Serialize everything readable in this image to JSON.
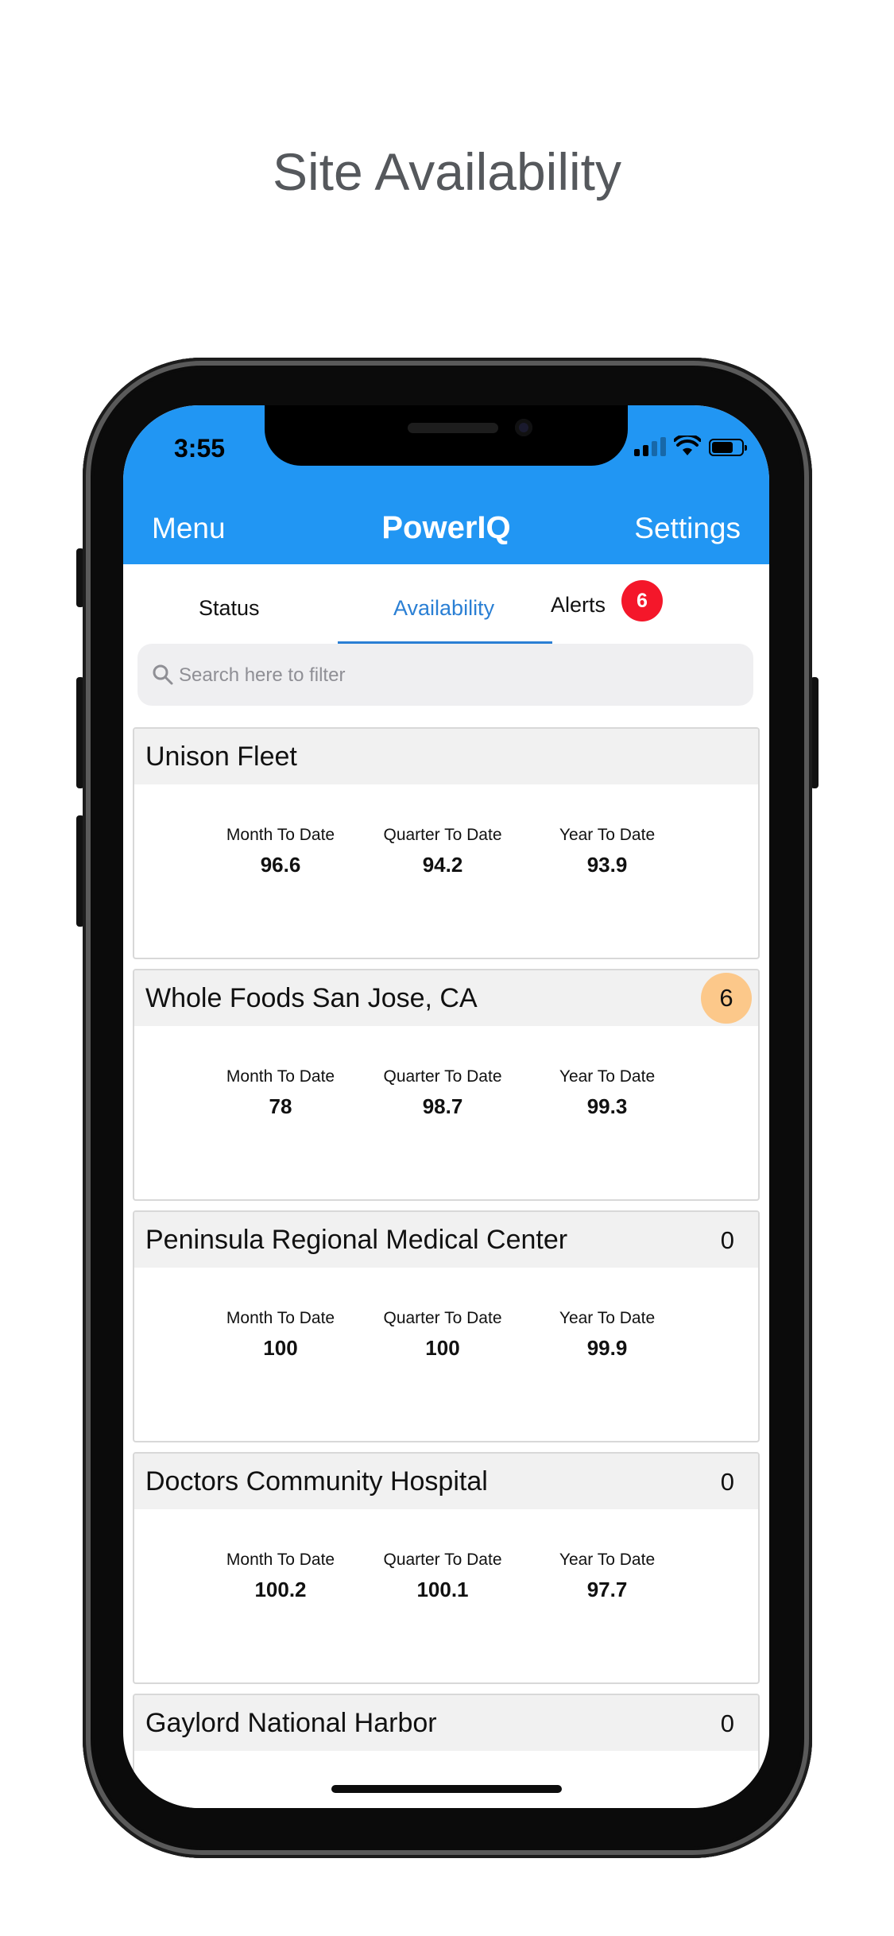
{
  "promo": {
    "title": "Site Availability"
  },
  "status_bar": {
    "time": "3:55"
  },
  "navbar": {
    "left": "Menu",
    "title": "PowerIQ",
    "right": "Settings"
  },
  "tabs": [
    {
      "label": "Status"
    },
    {
      "label": "Availability",
      "active": true
    },
    {
      "label": "Alerts",
      "badge": "6"
    }
  ],
  "search": {
    "placeholder": "Search here to filter"
  },
  "metric_labels": {
    "mtd": "Month To Date",
    "qtd": "Quarter To Date",
    "ytd": "Year To Date"
  },
  "sites": [
    {
      "name": "Unison Fleet",
      "count": "",
      "mtd": "96.6",
      "qtd": "94.2",
      "ytd": "93.9"
    },
    {
      "name": "Whole Foods San Jose, CA",
      "count": "6",
      "highlight": true,
      "mtd": "78",
      "qtd": "98.7",
      "ytd": "99.3"
    },
    {
      "name": "Peninsula Regional Medical Center",
      "count": "0",
      "mtd": "100",
      "qtd": "100",
      "ytd": "99.9"
    },
    {
      "name": "Doctors Community Hospital",
      "count": "0",
      "mtd": "100.2",
      "qtd": "100.1",
      "ytd": "97.7"
    },
    {
      "name": "Gaylord National Harbor",
      "count": "0"
    }
  ],
  "colors": {
    "primary": "#2196f3",
    "active_tab": "#2a7fd4",
    "alert_badge": "#f4172a",
    "count_highlight": "#fcc88a"
  }
}
